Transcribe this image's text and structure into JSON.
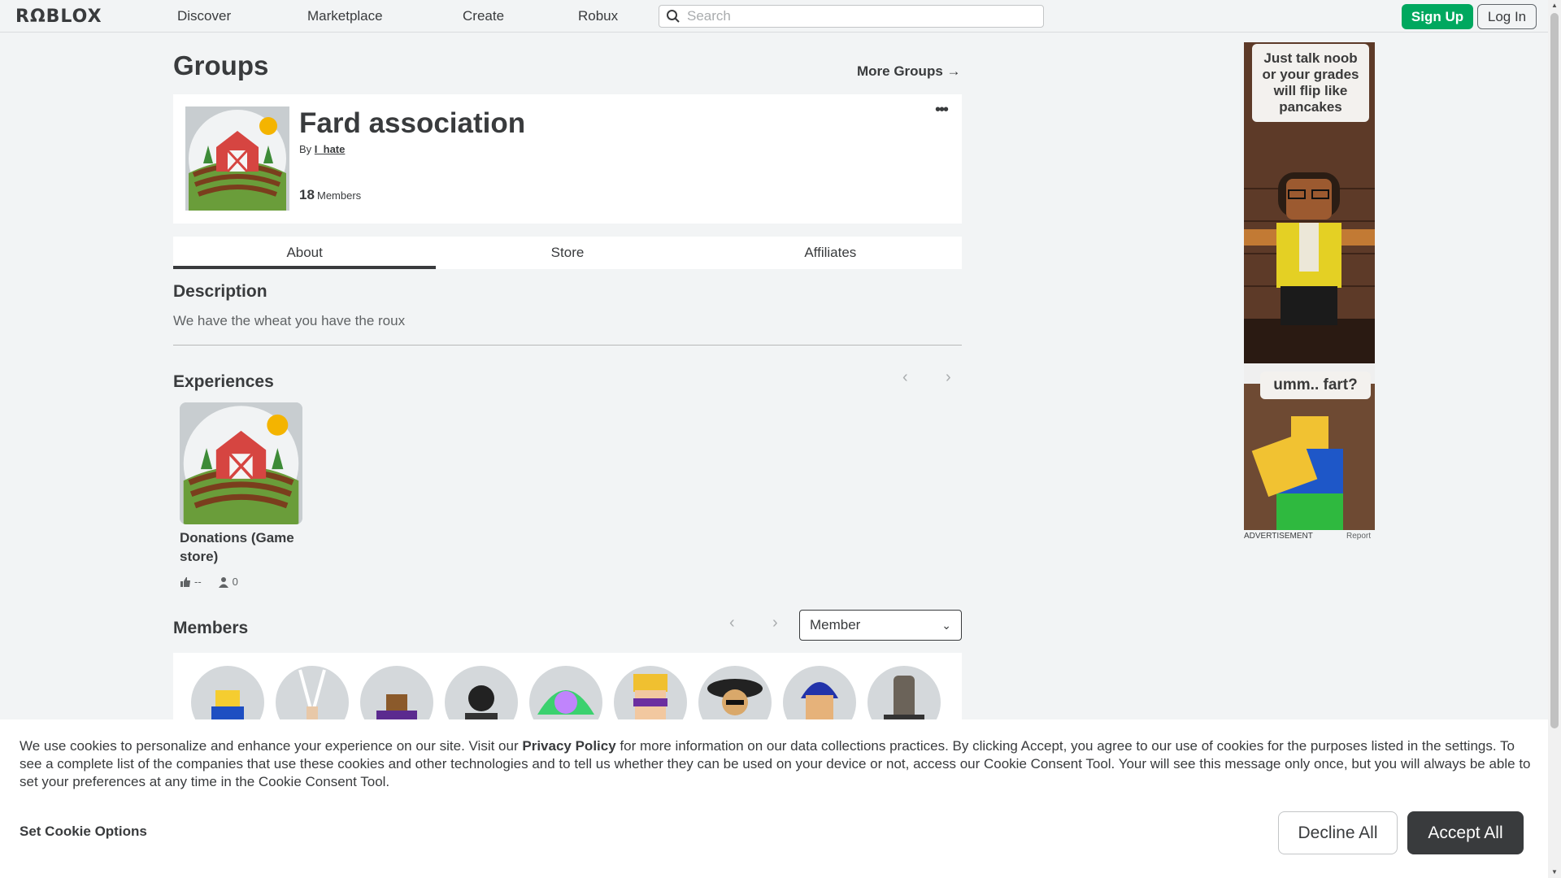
{
  "nav": {
    "logo": "RΩBLOX",
    "links": [
      "Discover",
      "Marketplace",
      "Create",
      "Robux"
    ],
    "search_placeholder": "Search",
    "signup": "Sign Up",
    "login": "Log In"
  },
  "page": {
    "title": "Groups",
    "more_groups": "More Groups →"
  },
  "group": {
    "name": "Fard association",
    "by": "By",
    "owner": "I_hate",
    "member_count": "18",
    "member_label": "Members",
    "more": "•••"
  },
  "tabs": [
    {
      "label": "About",
      "active": true
    },
    {
      "label": "Store",
      "active": false
    },
    {
      "label": "Affiliates",
      "active": false
    }
  ],
  "description": {
    "heading": "Description",
    "text": "We have the wheat you have the roux"
  },
  "experiences": {
    "heading": "Experiences",
    "items": [
      {
        "name": "Donations (Game store)",
        "rating": "--",
        "players": "0"
      }
    ]
  },
  "members": {
    "heading": "Members",
    "role_selected": "Member",
    "avatar_count": 9
  },
  "ad": {
    "top_text": "Just talk noob or your grades will flip like pancakes",
    "bottom_text": "umm.. fart?",
    "label": "ADVERTISEMENT",
    "report": "Report"
  },
  "cookie": {
    "text_before": "We use cookies to personalize and enhance your experience on our site. Visit our",
    "policy": "Privacy Policy",
    "text_after": "for more information on our data collections practices. By clicking Accept, you agree to our use of cookies for the purposes listed in the settings. To see a complete list of the companies that use these cookies and other technologies and to tell us whether they can be used on your device or not, access our Cookie Consent Tool. Your will see this message only once, but you will always be able to set your preferences at any time in the Cookie Consent Tool.",
    "options": "Set Cookie Options",
    "decline": "Decline All",
    "accept": "Accept All"
  },
  "colors": {
    "accent_green": "#00a85f",
    "text": "#393b3d",
    "background": "#f2f4f5"
  }
}
